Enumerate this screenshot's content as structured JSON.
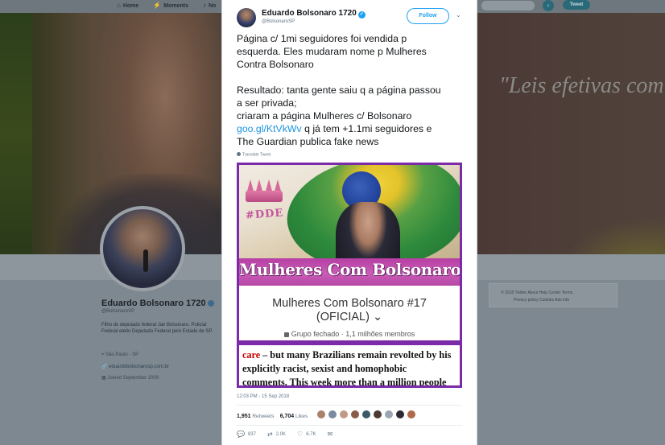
{
  "topnav": {
    "home": "Home",
    "moments": "Moments",
    "notifications": "No",
    "tweet_button": "Tweet"
  },
  "banner": {
    "slogan": "\"Leis efetivas com"
  },
  "profile": {
    "name": "Eduardo Bolsonaro 1720",
    "handle": "@BolsonaroSP",
    "bio": "Filho do deputado federal Jair Bolsonaro. Policial Federal eleito Deputado Federal pelo Estado de SP.",
    "location": "São Paulo - SP",
    "website": "eduardobolsonarosp.com.br",
    "joined": "Joined September 2009"
  },
  "footer_links": {
    "line1": "© 2018 Twitter   About   Help Center   Terms",
    "line2": "Privacy policy   Cookies   Ads info"
  },
  "tweet": {
    "author_name": "Eduardo Bolsonaro 1720",
    "author_handle": "@BolsonaroSP",
    "follow_label": "Follow",
    "text_line1": "Página c/ 1mi seguidores foi vendida p",
    "text_line2": "esquerda. Eles mudaram nome p  Mulheres",
    "text_line3": "Contra Bolsonaro",
    "text_line4": "Resultado: tanta gente saiu q a página passou",
    "text_line5": "a ser privada;",
    "text_line6": "criaram a página Mulheres c/ Bolsonaro",
    "link": "goo.gl/KtVkWv",
    "text_line7_rest": " q já tem +1.1mi seguidores e",
    "text_line8": "The Guardian publica fake news",
    "translate": "Translate Tweet",
    "image": {
      "tag": "#DDE",
      "banner_text": "Mulheres Com Bolsonaro",
      "group_title_1": "Mulheres Com Bolsonaro #17",
      "group_title_2": "(OFICIAL)",
      "group_sub": "Grupo fechado · 1,1 milhões membros",
      "article_red": "care",
      "article_line1": " – but many Brazilians remain revolted by his",
      "article_line2": "explicitly racist, sexist and homophobic",
      "article_line3": "comments. This week more than a million people"
    },
    "timestamp": "12:03 PM - 15 Sep 2018",
    "retweets_count": "1,951",
    "retweets_label": "Retweets",
    "likes_count": "6,704",
    "likes_label": "Likes",
    "reply_count": "837",
    "retweet_action_count": "2.0K",
    "like_action_count": "6.7K"
  },
  "colors": {
    "accent": "#1da1f2",
    "link": "#1b95e0",
    "image_border": "#7b2aa8"
  }
}
